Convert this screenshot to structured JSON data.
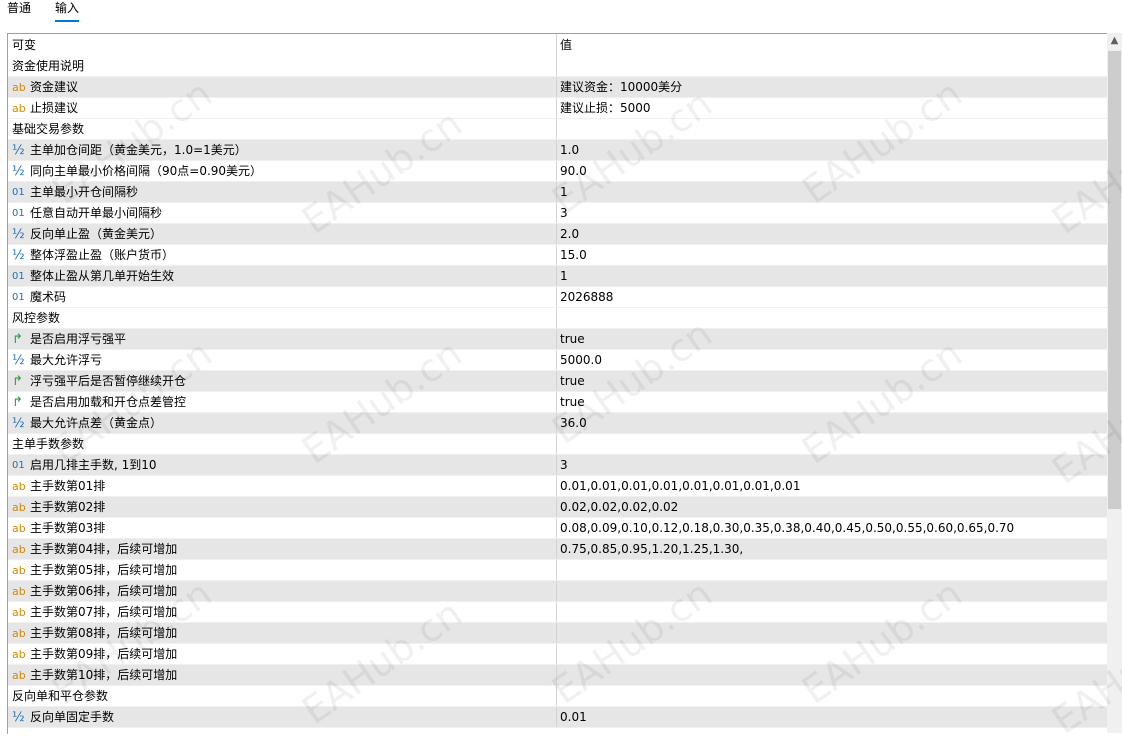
{
  "tabs": [
    "普通",
    "输入"
  ],
  "active_tab": 1,
  "columns": {
    "name": "可变",
    "value": "值"
  },
  "rows": [
    {
      "type": "section",
      "name": "资金使用说明",
      "value": ""
    },
    {
      "type": "param",
      "icon": "ab",
      "name": "资金建议",
      "value": "建议资金：10000美分"
    },
    {
      "type": "param",
      "icon": "ab",
      "name": "止损建议",
      "value": "建议止损：5000"
    },
    {
      "type": "section",
      "name": "基础交易参数",
      "value": ""
    },
    {
      "type": "param",
      "icon": "half",
      "name": "主单加仓间距（黄金美元，1.0=1美元）",
      "value": "1.0"
    },
    {
      "type": "param",
      "icon": "half",
      "name": "同向主单最小价格间隔（90点=0.90美元）",
      "value": "90.0"
    },
    {
      "type": "param",
      "icon": "01",
      "name": "主单最小开仓间隔秒",
      "value": "1"
    },
    {
      "type": "param",
      "icon": "01",
      "name": "任意自动开单最小间隔秒",
      "value": "3"
    },
    {
      "type": "param",
      "icon": "half",
      "name": "反向单止盈（黄金美元）",
      "value": "2.0"
    },
    {
      "type": "param",
      "icon": "half",
      "name": "整体浮盈止盈（账户货币）",
      "value": "15.0"
    },
    {
      "type": "param",
      "icon": "01",
      "name": "整体止盈从第几单开始生效",
      "value": "1"
    },
    {
      "type": "param",
      "icon": "01",
      "name": "魔术码",
      "value": "2026888"
    },
    {
      "type": "section",
      "name": "风控参数",
      "value": ""
    },
    {
      "type": "param",
      "icon": "bool",
      "name": "是否启用浮亏强平",
      "value": "true"
    },
    {
      "type": "param",
      "icon": "half",
      "name": "最大允许浮亏",
      "value": "5000.0"
    },
    {
      "type": "param",
      "icon": "bool",
      "name": "浮亏强平后是否暂停继续开仓",
      "value": "true"
    },
    {
      "type": "param",
      "icon": "bool",
      "name": "是否启用加载和开仓点差管控",
      "value": "true"
    },
    {
      "type": "param",
      "icon": "half",
      "name": "最大允许点差（黄金点）",
      "value": "36.0"
    },
    {
      "type": "section",
      "name": "主单手数参数",
      "value": ""
    },
    {
      "type": "param",
      "icon": "01",
      "name": "启用几排主手数, 1到10",
      "value": "3"
    },
    {
      "type": "param",
      "icon": "ab",
      "name": "主手数第01排",
      "value": "0.01,0.01,0.01,0.01,0.01,0.01,0.01,0.01"
    },
    {
      "type": "param",
      "icon": "ab",
      "name": "主手数第02排",
      "value": "0.02,0.02,0.02,0.02"
    },
    {
      "type": "param",
      "icon": "ab",
      "name": "主手数第03排",
      "value": "0.08,0.09,0.10,0.12,0.18,0.30,0.35,0.38,0.40,0.45,0.50,0.55,0.60,0.65,0.70"
    },
    {
      "type": "param",
      "icon": "ab",
      "name": "主手数第04排，后续可增加",
      "value": "0.75,0.85,0.95,1.20,1.25,1.30,"
    },
    {
      "type": "param",
      "icon": "ab",
      "name": "主手数第05排，后续可增加",
      "value": ""
    },
    {
      "type": "param",
      "icon": "ab",
      "name": "主手数第06排，后续可增加",
      "value": ""
    },
    {
      "type": "param",
      "icon": "ab",
      "name": "主手数第07排，后续可增加",
      "value": ""
    },
    {
      "type": "param",
      "icon": "ab",
      "name": "主手数第08排，后续可增加",
      "value": ""
    },
    {
      "type": "param",
      "icon": "ab",
      "name": "主手数第09排，后续可增加",
      "value": ""
    },
    {
      "type": "param",
      "icon": "ab",
      "name": "主手数第10排，后续可增加",
      "value": ""
    },
    {
      "type": "section",
      "name": "反向单和平仓参数",
      "value": ""
    },
    {
      "type": "param",
      "icon": "half",
      "name": "反向单固定手数",
      "value": "0.01"
    }
  ],
  "icons": {
    "ab": "ab",
    "01": "01",
    "half": "½",
    "bool": "↱"
  },
  "watermark": "EAHub.cn",
  "colors": {
    "row_shade": "#e6e6e6",
    "tab_underline": "#0078d7",
    "icon_ab": "#d08b00",
    "icon_num": "#1e6fb8",
    "icon_bool": "#2f9a3c"
  }
}
